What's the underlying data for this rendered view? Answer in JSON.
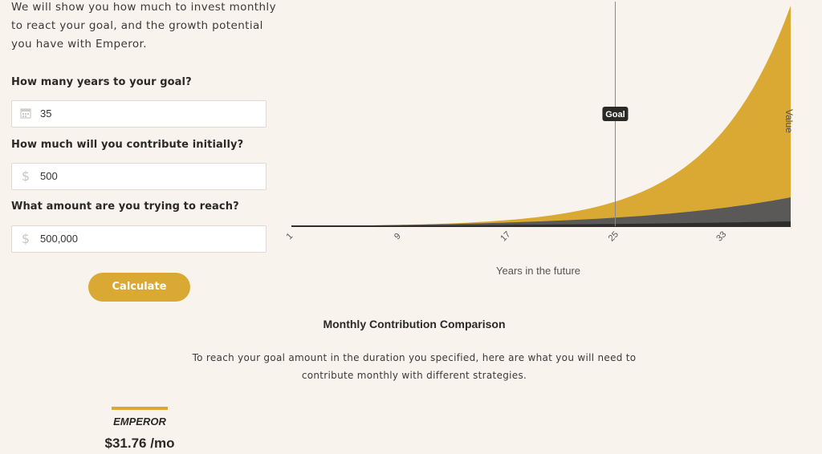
{
  "intro": {
    "line1": "We will show you how much to invest monthly",
    "line2": "to react your goal, and the growth potential",
    "line3": "you have with Emperor."
  },
  "form": {
    "years_label": "How many years to your goal?",
    "years_value": "35",
    "years_icon": "calendar-icon",
    "initial_label": "How much will you contribute initially?",
    "initial_value": "500",
    "initial_icon": "dollar-icon",
    "target_label": "What amount are you trying to reach?",
    "target_value": "500,000",
    "target_icon": "dollar-icon",
    "calculate_label": "Calculate"
  },
  "chart_data": {
    "type": "area",
    "xlabel": "Years in the future",
    "ylabel": "Value",
    "x_ticks": [
      "1",
      "9",
      "17",
      "25",
      "33"
    ],
    "goal_marker": {
      "label": "Goal",
      "x": 25
    },
    "x_range": [
      1,
      38
    ],
    "series": [
      {
        "color": "#d9a934",
        "shape": "exponential-top"
      },
      {
        "color": "#5a5957",
        "shape": "moderate"
      },
      {
        "color": "#2f2e2d",
        "shape": "flat"
      }
    ],
    "grid": false
  },
  "comparison": {
    "title": "Monthly Contribution Comparison",
    "desc_line1": "To reach your goal amount in the duration you specified, here are what you will need to",
    "desc_line2": "contribute monthly with different strategies.",
    "emperor_name": "EMPEROR",
    "emperor_price": "$31.76 /mo"
  },
  "colors": {
    "accent": "#d9a934",
    "background": "#f8f3ec",
    "dark_area": "#5a5957"
  }
}
